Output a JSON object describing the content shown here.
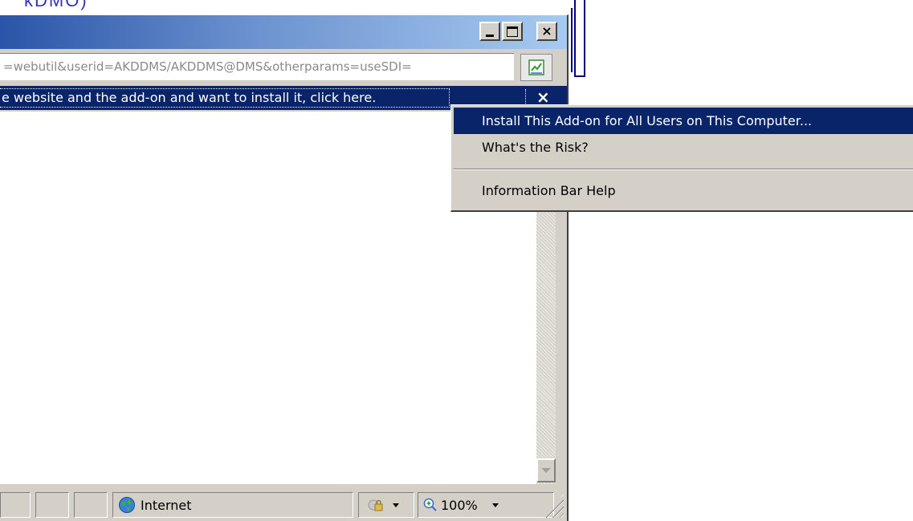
{
  "background": {
    "partial_text": "kDMO)"
  },
  "window": {
    "buttons": {
      "minimize_icon": "minimize-icon",
      "maximize_icon": "maximize-icon",
      "close_label": "×"
    }
  },
  "address_bar": {
    "value": "=webutil&userid=AKDDMS/AKDDMS@DMS&otherparams=useSDI=",
    "go_icon": "go-icon"
  },
  "info_bar": {
    "message": "e website and the add-on and want to install it, click here.",
    "close_label": "×"
  },
  "context_menu": {
    "items": [
      {
        "label": "Install This Add-on for All Users on This Computer...",
        "highlighted": true
      },
      {
        "label": "What's the Risk?",
        "highlighted": false
      },
      {
        "label": "Information Bar Help",
        "highlighted": false
      }
    ]
  },
  "status_bar": {
    "zone_label": "Internet",
    "zone_icon": "globe-icon",
    "security_icon": "lock-icon",
    "zoom_label": "100%",
    "zoom_icon": "zoom-icon"
  },
  "colors": {
    "highlight": "#0a246a",
    "face": "#d4d0c8",
    "title_start": "#2a55a8",
    "title_end": "#a6caf0"
  }
}
